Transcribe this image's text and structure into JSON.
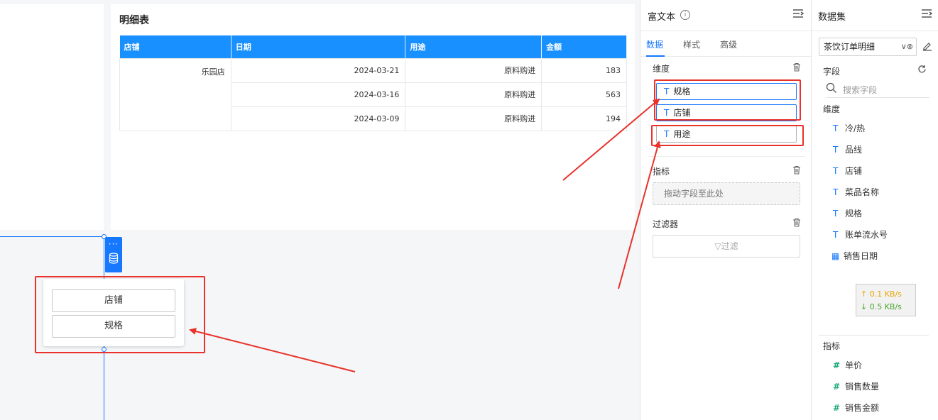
{
  "table_card": {
    "title": "明细表",
    "columns": [
      "店铺",
      "日期",
      "用途",
      "金额"
    ],
    "store": "乐园店",
    "rows": [
      {
        "date": "2024-03-21",
        "usage": "原料购进",
        "amount": "183"
      },
      {
        "date": "2024-03-16",
        "usage": "原料购进",
        "amount": "563"
      },
      {
        "date": "2024-03-09",
        "usage": "原料购进",
        "amount": "194"
      }
    ]
  },
  "tool_strip": {
    "more": "···"
  },
  "filter_popup": {
    "buttons": [
      "店铺",
      "规格"
    ]
  },
  "config_panel": {
    "title": "富文本",
    "info_glyph": "i",
    "tabs": [
      "数据",
      "样式",
      "高级"
    ],
    "dimension": {
      "label": "维度",
      "type_glyph": "T",
      "chips": [
        "规格",
        "店铺",
        "用途"
      ]
    },
    "metric": {
      "label": "指标",
      "placeholder": "拖动字段至此处"
    },
    "filter": {
      "label": "过滤器",
      "button": "▽过滤"
    }
  },
  "dataset_panel": {
    "title": "数据集",
    "selected": "茶饮订单明细",
    "select_arrows": "∨⊗",
    "fields_label": "字段",
    "search_placeholder": "搜索字段",
    "dimension_label": "维度",
    "dimension_fields": [
      {
        "icon": "T",
        "name": "冷/热"
      },
      {
        "icon": "T",
        "name": "品线"
      },
      {
        "icon": "T",
        "name": "店铺"
      },
      {
        "icon": "T",
        "name": "菜品名称"
      },
      {
        "icon": "T",
        "name": "规格"
      },
      {
        "icon": "T",
        "name": "账单流水号"
      },
      {
        "icon": "▦",
        "name": "销售日期"
      }
    ],
    "metric_label": "指标",
    "metric_fields": [
      {
        "icon": "#",
        "name": "单价"
      },
      {
        "icon": "#",
        "name": "销售数量"
      },
      {
        "icon": "#",
        "name": "销售金额"
      }
    ]
  },
  "speed": {
    "up": "↑ 0.1 KB/s",
    "down": "↓ 0.5 KB/s"
  },
  "colors": {
    "accent": "#1677ff",
    "annotation": "#e8322b"
  }
}
